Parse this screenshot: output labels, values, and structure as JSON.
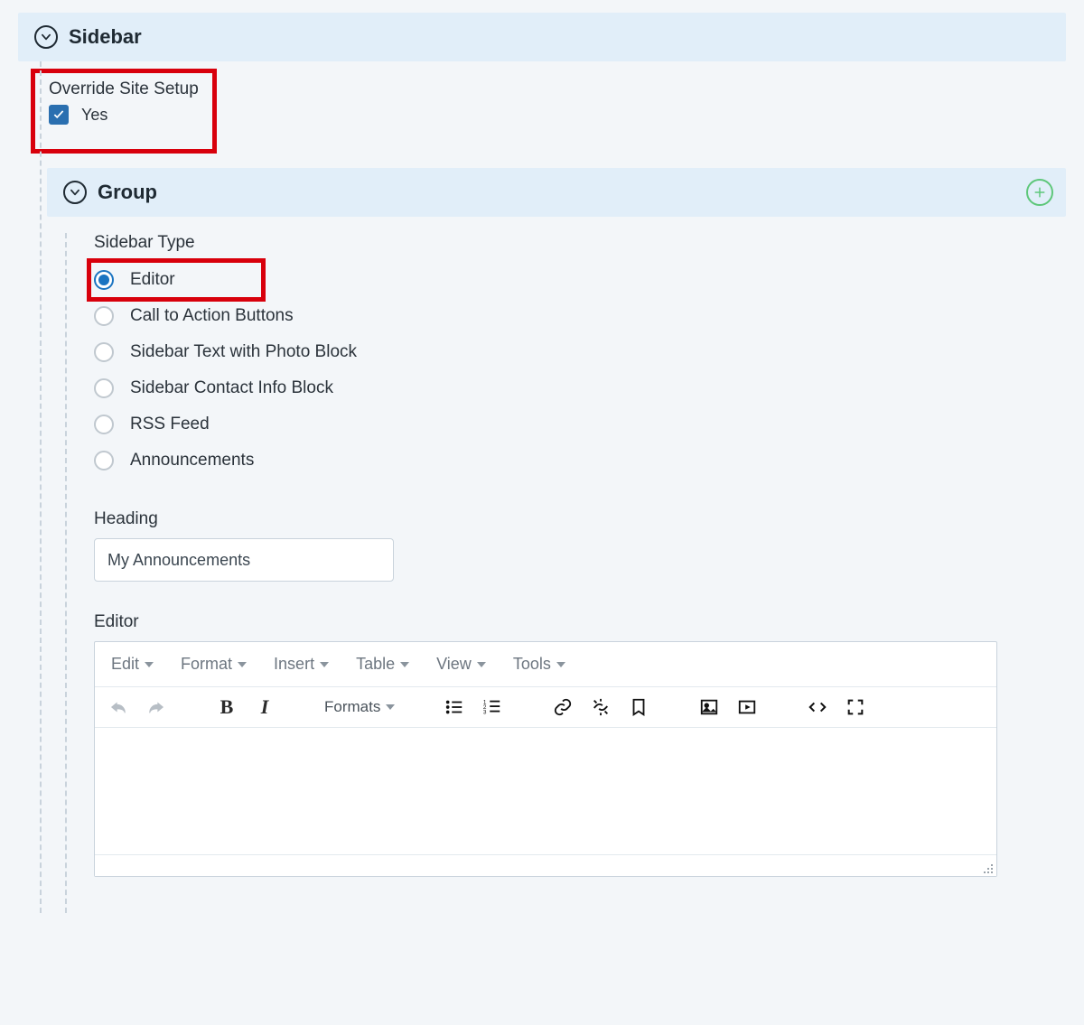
{
  "sidebar_section": {
    "title": "Sidebar"
  },
  "override": {
    "label": "Override Site Setup",
    "checkbox_label": "Yes",
    "checked": true
  },
  "group_section": {
    "title": "Group"
  },
  "sidebar_type": {
    "label": "Sidebar Type",
    "options": [
      "Editor",
      "Call to Action Buttons",
      "Sidebar Text with Photo Block",
      "Sidebar Contact Info Block",
      "RSS Feed",
      "Announcements"
    ],
    "selected_index": 0
  },
  "heading_field": {
    "label": "Heading",
    "value": "My Announcements"
  },
  "editor_field": {
    "label": "Editor",
    "menus": [
      "Edit",
      "Format",
      "Insert",
      "Table",
      "View",
      "Tools"
    ],
    "formats_button": "Formats"
  },
  "colors": {
    "highlight": "#d8000c",
    "accent": "#1b74c1",
    "section_bg": "#e1eef9",
    "add_green": "#5ec77a"
  }
}
